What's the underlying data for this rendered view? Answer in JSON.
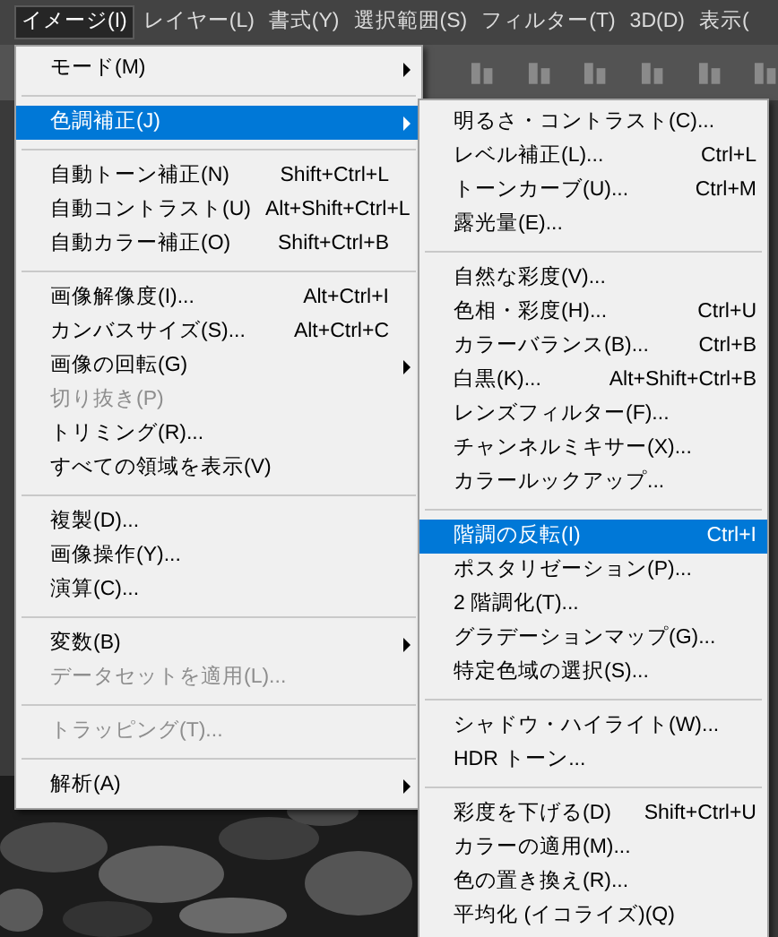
{
  "menubar": [
    {
      "label": "イメージ(I)",
      "selected": true
    },
    {
      "label": "レイヤー(L)",
      "selected": false
    },
    {
      "label": "書式(Y)",
      "selected": false
    },
    {
      "label": "選択範囲(S)",
      "selected": false
    },
    {
      "label": "フィルター(T)",
      "selected": false
    },
    {
      "label": "3D(D)",
      "selected": false
    },
    {
      "label": "表示(",
      "selected": false
    }
  ],
  "menu": [
    {
      "kind": "item",
      "label": "モード(M)",
      "submenu": true,
      "disabled": false,
      "selected": false
    },
    {
      "kind": "separator"
    },
    {
      "kind": "item",
      "label": "色調補正(J)",
      "submenu": true,
      "disabled": false,
      "selected": true
    },
    {
      "kind": "separator"
    },
    {
      "kind": "item",
      "label": "自動トーン補正(N)",
      "shortcut": "Shift+Ctrl+L",
      "submenu": false,
      "disabled": false,
      "selected": false
    },
    {
      "kind": "item",
      "label": "自動コントラスト(U)",
      "shortcut": "Alt+Shift+Ctrl+L",
      "submenu": false,
      "disabled": false,
      "selected": false
    },
    {
      "kind": "item",
      "label": "自動カラー補正(O)",
      "shortcut": "Shift+Ctrl+B",
      "submenu": false,
      "disabled": false,
      "selected": false
    },
    {
      "kind": "separator"
    },
    {
      "kind": "item",
      "label": "画像解像度(I)...",
      "shortcut": "Alt+Ctrl+I",
      "submenu": false,
      "disabled": false,
      "selected": false
    },
    {
      "kind": "item",
      "label": "カンバスサイズ(S)...",
      "shortcut": "Alt+Ctrl+C",
      "submenu": false,
      "disabled": false,
      "selected": false
    },
    {
      "kind": "item",
      "label": "画像の回転(G)",
      "submenu": true,
      "disabled": false,
      "selected": false
    },
    {
      "kind": "item",
      "label": "切り抜き(P)",
      "submenu": false,
      "disabled": true,
      "selected": false
    },
    {
      "kind": "item",
      "label": "トリミング(R)...",
      "submenu": false,
      "disabled": false,
      "selected": false
    },
    {
      "kind": "item",
      "label": "すべての領域を表示(V)",
      "submenu": false,
      "disabled": false,
      "selected": false
    },
    {
      "kind": "separator"
    },
    {
      "kind": "item",
      "label": "複製(D)...",
      "submenu": false,
      "disabled": false,
      "selected": false
    },
    {
      "kind": "item",
      "label": "画像操作(Y)...",
      "submenu": false,
      "disabled": false,
      "selected": false
    },
    {
      "kind": "item",
      "label": "演算(C)...",
      "submenu": false,
      "disabled": false,
      "selected": false
    },
    {
      "kind": "separator"
    },
    {
      "kind": "item",
      "label": "変数(B)",
      "submenu": true,
      "disabled": false,
      "selected": false
    },
    {
      "kind": "item",
      "label": "データセットを適用(L)...",
      "submenu": false,
      "disabled": true,
      "selected": false
    },
    {
      "kind": "separator"
    },
    {
      "kind": "item",
      "label": "トラッピング(T)...",
      "submenu": false,
      "disabled": true,
      "selected": false
    },
    {
      "kind": "separator"
    },
    {
      "kind": "item",
      "label": "解析(A)",
      "submenu": true,
      "disabled": false,
      "selected": false
    }
  ],
  "submenu": [
    {
      "kind": "item",
      "label": "明るさ・コントラスト(C)...",
      "selected": false
    },
    {
      "kind": "item",
      "label": "レベル補正(L)...",
      "shortcut": "Ctrl+L",
      "selected": false
    },
    {
      "kind": "item",
      "label": "トーンカーブ(U)...",
      "shortcut": "Ctrl+M",
      "selected": false
    },
    {
      "kind": "item",
      "label": "露光量(E)...",
      "selected": false
    },
    {
      "kind": "separator"
    },
    {
      "kind": "item",
      "label": "自然な彩度(V)...",
      "selected": false
    },
    {
      "kind": "item",
      "label": "色相・彩度(H)...",
      "shortcut": "Ctrl+U",
      "selected": false
    },
    {
      "kind": "item",
      "label": "カラーバランス(B)...",
      "shortcut": "Ctrl+B",
      "selected": false
    },
    {
      "kind": "item",
      "label": "白黒(K)...",
      "shortcut": "Alt+Shift+Ctrl+B",
      "selected": false
    },
    {
      "kind": "item",
      "label": "レンズフィルター(F)...",
      "selected": false
    },
    {
      "kind": "item",
      "label": "チャンネルミキサー(X)...",
      "selected": false
    },
    {
      "kind": "item",
      "label": "カラールックアップ...",
      "selected": false
    },
    {
      "kind": "separator"
    },
    {
      "kind": "item",
      "label": "階調の反転(I)",
      "shortcut": "Ctrl+I",
      "selected": true
    },
    {
      "kind": "item",
      "label": "ポスタリゼーション(P)...",
      "selected": false
    },
    {
      "kind": "item",
      "label": "2 階調化(T)...",
      "selected": false
    },
    {
      "kind": "item",
      "label": "グラデーションマップ(G)...",
      "selected": false
    },
    {
      "kind": "item",
      "label": "特定色域の選択(S)...",
      "selected": false
    },
    {
      "kind": "separator"
    },
    {
      "kind": "item",
      "label": "シャドウ・ハイライト(W)...",
      "selected": false
    },
    {
      "kind": "item",
      "label": "HDR トーン...",
      "selected": false
    },
    {
      "kind": "separator"
    },
    {
      "kind": "item",
      "label": "彩度を下げる(D)",
      "shortcut": "Shift+Ctrl+U",
      "selected": false
    },
    {
      "kind": "item",
      "label": "カラーの適用(M)...",
      "selected": false
    },
    {
      "kind": "item",
      "label": "色の置き換え(R)...",
      "selected": false
    },
    {
      "kind": "item",
      "label": "平均化 (イコライズ)(Q)",
      "selected": false
    }
  ]
}
